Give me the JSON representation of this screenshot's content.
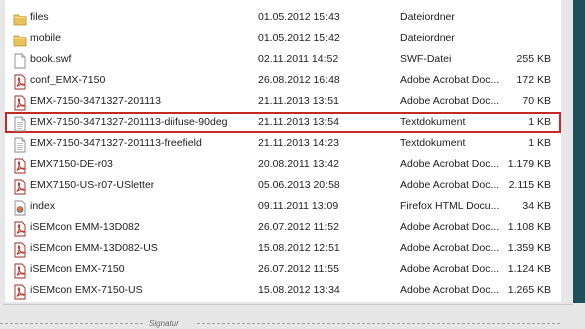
{
  "files": [
    {
      "name": "files",
      "date": "01.05.2012 15:43",
      "type": "Dateiordner",
      "size": "",
      "icon": "folder-icon",
      "selected": false
    },
    {
      "name": "mobile",
      "date": "01.05.2012 15:42",
      "type": "Dateiordner",
      "size": "",
      "icon": "folder-icon",
      "selected": false
    },
    {
      "name": "book.swf",
      "date": "02.11.2011 14:52",
      "type": "SWF-Datei",
      "size": "255 KB",
      "icon": "generic-file-icon",
      "selected": false
    },
    {
      "name": "conf_EMX-7150",
      "date": "26.08.2012 16:48",
      "type": "Adobe Acrobat Doc...",
      "size": "172 KB",
      "icon": "pdf-icon",
      "selected": false
    },
    {
      "name": "EMX-7150-3471327-201113",
      "date": "21.11.2013 13:51",
      "type": "Adobe Acrobat Doc...",
      "size": "70 KB",
      "icon": "pdf-icon",
      "selected": false
    },
    {
      "name": "EMX-7150-3471327-201113-diifuse-90deg",
      "date": "21.11.2013 13:54",
      "type": "Textdokument",
      "size": "1 KB",
      "icon": "text-file-icon",
      "selected": true
    },
    {
      "name": "EMX-7150-3471327-201113-freefield",
      "date": "21.11.2013 14:23",
      "type": "Textdokument",
      "size": "1 KB",
      "icon": "text-file-icon",
      "selected": false
    },
    {
      "name": "EMX7150-DE-r03",
      "date": "20.08.2011 13:42",
      "type": "Adobe Acrobat Doc...",
      "size": "1.179 KB",
      "icon": "pdf-icon",
      "selected": false
    },
    {
      "name": "EMX7150-US-r07-USletter",
      "date": "05.06.2013 20:58",
      "type": "Adobe Acrobat Doc...",
      "size": "2.115 KB",
      "icon": "pdf-icon",
      "selected": false
    },
    {
      "name": "index",
      "date": "09.11.2011 13:09",
      "type": "Firefox HTML Docu...",
      "size": "34 KB",
      "icon": "html-file-icon",
      "selected": false
    },
    {
      "name": "iSEMcon EMM-13D082",
      "date": "26.07.2012 11:52",
      "type": "Adobe Acrobat Doc...",
      "size": "1.108 KB",
      "icon": "pdf-icon",
      "selected": false
    },
    {
      "name": "iSEMcon EMM-13D082-US",
      "date": "15.08.2012 12:51",
      "type": "Adobe Acrobat Doc...",
      "size": "1.359 KB",
      "icon": "pdf-icon",
      "selected": false
    },
    {
      "name": "iSEMcon EMX-7150",
      "date": "26.07.2012 11:55",
      "type": "Adobe Acrobat Doc...",
      "size": "1.124 KB",
      "icon": "pdf-icon",
      "selected": false
    },
    {
      "name": "iSEMcon EMX-7150-US",
      "date": "15.08.2012 13:34",
      "type": "Adobe Acrobat Doc...",
      "size": "1.265 KB",
      "icon": "pdf-icon",
      "selected": false
    }
  ],
  "signature_label": "Signatur",
  "colors": {
    "selection_border": "#c62828",
    "accent_strip": "#1e4f5b",
    "folder": "#e8c25a",
    "pdf": "#c0392b"
  }
}
